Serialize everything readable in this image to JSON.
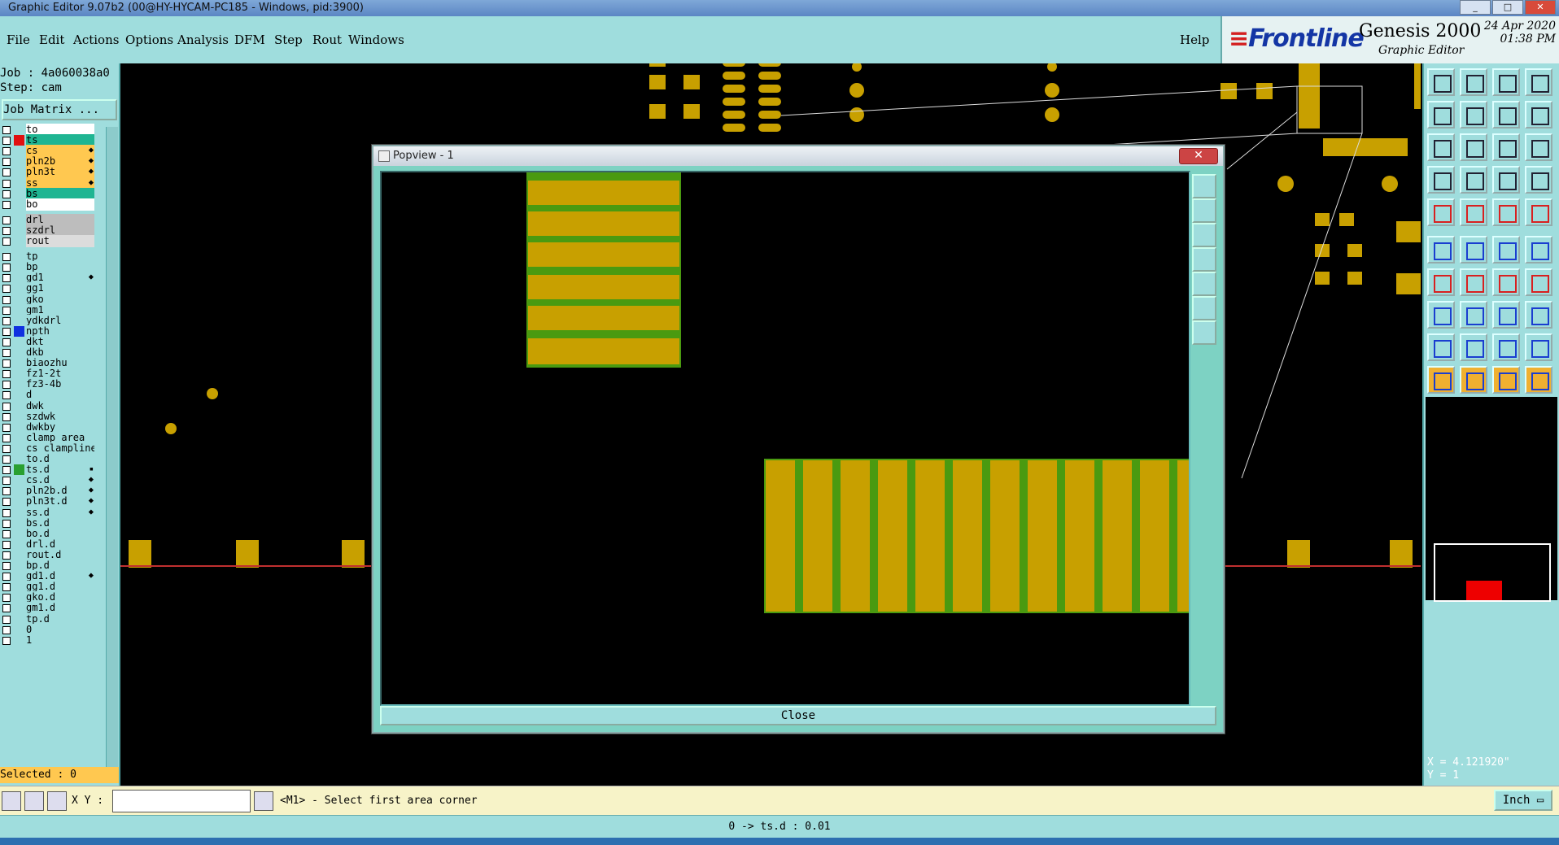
{
  "window": {
    "title": "Graphic Editor 9.07b2 (00@HY-HYCAM-PC185 - Windows, pid:3900)",
    "controls": [
      "_",
      "□",
      "✕"
    ]
  },
  "menu": {
    "items": [
      "File",
      "Edit",
      "Actions",
      "Options",
      "Analysis",
      "DFM",
      "Step",
      "Rout",
      "Windows"
    ],
    "help": "Help"
  },
  "brand": {
    "logo": "Frontline",
    "product": "Genesis 2000",
    "subtitle": "Graphic Editor",
    "date": "24 Apr 2020",
    "time": "01:38 PM"
  },
  "job": {
    "job_label": "Job : 4a060038a0",
    "step_label": "Step: cam",
    "job_matrix_button": "Job Matrix ..."
  },
  "layers": [
    {
      "name": "to",
      "color": "#ffffff",
      "swatch": ""
    },
    {
      "name": "ts",
      "color": "#1fb592",
      "swatch": "#e01010"
    },
    {
      "name": "cs",
      "color": "#ffc850",
      "swatch": "",
      "mark": "⬥"
    },
    {
      "name": "pln2b",
      "color": "#ffc850",
      "swatch": "",
      "mark": "⬥"
    },
    {
      "name": "pln3t",
      "color": "#ffc850",
      "swatch": "",
      "mark": "⬥"
    },
    {
      "name": "ss",
      "color": "#ffc850",
      "swatch": "",
      "mark": "⬥"
    },
    {
      "name": "bs",
      "color": "#1fb592",
      "swatch": ""
    },
    {
      "name": "bo",
      "color": "#ffffff",
      "swatch": ""
    },
    {
      "name": "drl",
      "color": "#bdbdbd",
      "swatch": ""
    },
    {
      "name": "szdrl",
      "color": "#bdbdbd",
      "swatch": ""
    },
    {
      "name": "rout",
      "color": "#dcdcdc",
      "swatch": ""
    },
    {
      "name": "tp",
      "color": "#9fdddd",
      "swatch": ""
    },
    {
      "name": "bp",
      "color": "#9fdddd",
      "swatch": ""
    },
    {
      "name": "gd1",
      "color": "#9fdddd",
      "swatch": "",
      "mark": "⬥"
    },
    {
      "name": "gg1",
      "color": "#9fdddd",
      "swatch": ""
    },
    {
      "name": "gko",
      "color": "#9fdddd",
      "swatch": ""
    },
    {
      "name": "gm1",
      "color": "#9fdddd",
      "swatch": ""
    },
    {
      "name": "ydkdrl",
      "color": "#9fdddd",
      "swatch": ""
    },
    {
      "name": "npth",
      "color": "#9fdddd",
      "swatch": "#1030e0"
    },
    {
      "name": "dkt",
      "color": "#9fdddd",
      "swatch": ""
    },
    {
      "name": "dkb",
      "color": "#9fdddd",
      "swatch": ""
    },
    {
      "name": "biaozhu",
      "color": "#9fdddd",
      "swatch": ""
    },
    {
      "name": "fz1-2t",
      "color": "#9fdddd",
      "swatch": ""
    },
    {
      "name": "fz3-4b",
      "color": "#9fdddd",
      "swatch": ""
    },
    {
      "name": "d",
      "color": "#9fdddd",
      "swatch": ""
    },
    {
      "name": "dwk",
      "color": "#9fdddd",
      "swatch": ""
    },
    {
      "name": "szdwk",
      "color": "#9fdddd",
      "swatch": ""
    },
    {
      "name": "dwkby",
      "color": "#9fdddd",
      "swatch": ""
    },
    {
      "name": "clamp_area",
      "color": "#9fdddd",
      "swatch": ""
    },
    {
      "name": "cs_clampline",
      "color": "#9fdddd",
      "swatch": ""
    },
    {
      "name": "to.d",
      "color": "#9fdddd",
      "swatch": ""
    },
    {
      "name": "ts.d",
      "color": "#9fdddd",
      "swatch": "#2aa030",
      "mark": "▪"
    },
    {
      "name": "cs.d",
      "color": "#9fdddd",
      "swatch": "",
      "mark": "⬥"
    },
    {
      "name": "pln2b.d",
      "color": "#9fdddd",
      "swatch": "",
      "mark": "⬥"
    },
    {
      "name": "pln3t.d",
      "color": "#9fdddd",
      "swatch": "",
      "mark": "⬥"
    },
    {
      "name": "ss.d",
      "color": "#9fdddd",
      "swatch": "",
      "mark": "⬥"
    },
    {
      "name": "bs.d",
      "color": "#9fdddd",
      "swatch": ""
    },
    {
      "name": "bo.d",
      "color": "#9fdddd",
      "swatch": ""
    },
    {
      "name": "drl.d",
      "color": "#9fdddd",
      "swatch": ""
    },
    {
      "name": "rout.d",
      "color": "#9fdddd",
      "swatch": ""
    },
    {
      "name": "bp.d",
      "color": "#9fdddd",
      "swatch": ""
    },
    {
      "name": "gd1.d",
      "color": "#9fdddd",
      "swatch": "",
      "mark": "⬥"
    },
    {
      "name": "gg1.d",
      "color": "#9fdddd",
      "swatch": ""
    },
    {
      "name": "gko.d",
      "color": "#9fdddd",
      "swatch": ""
    },
    {
      "name": "gm1.d",
      "color": "#9fdddd",
      "swatch": ""
    },
    {
      "name": "tp.d",
      "color": "#9fdddd",
      "swatch": ""
    },
    {
      "name": "0",
      "color": "#9fdddd",
      "swatch": ""
    },
    {
      "name": "1",
      "color": "#9fdddd",
      "swatch": ""
    }
  ],
  "selected": "Selected : 0",
  "popview": {
    "title": "Popview - 1",
    "close_button": "Close"
  },
  "coords": {
    "x": "X = 4.121920\"",
    "y": "Y = 1"
  },
  "command": {
    "xy_label": "X Y :",
    "xy_value": "",
    "prompt": "<M1> - Select first area corner",
    "units": "Inch"
  },
  "status": "0 -> ts.d : 0.01",
  "colors": {
    "copper": "#c8a000",
    "green": "#4a9a10",
    "panel": "#9fdddd",
    "popview": "#7dd2c3"
  }
}
